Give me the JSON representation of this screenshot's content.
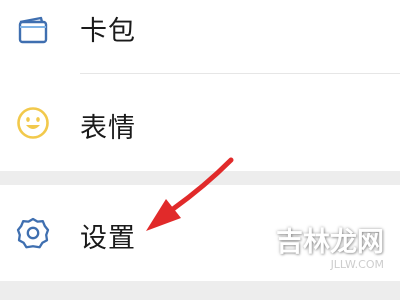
{
  "menu": {
    "items": [
      {
        "label": "卡包",
        "icon": "card-wallet-icon"
      },
      {
        "label": "表情",
        "icon": "smiley-icon"
      },
      {
        "label": "设置",
        "icon": "gear-icon"
      }
    ]
  },
  "colors": {
    "icon_blue": "#3f6fb0",
    "icon_yellow": "#f2c94c",
    "arrow_red": "#e12a2a",
    "section_gap": "#ededed"
  },
  "watermark": {
    "text": "吉林龙网",
    "sub": "JLLW.COM"
  }
}
